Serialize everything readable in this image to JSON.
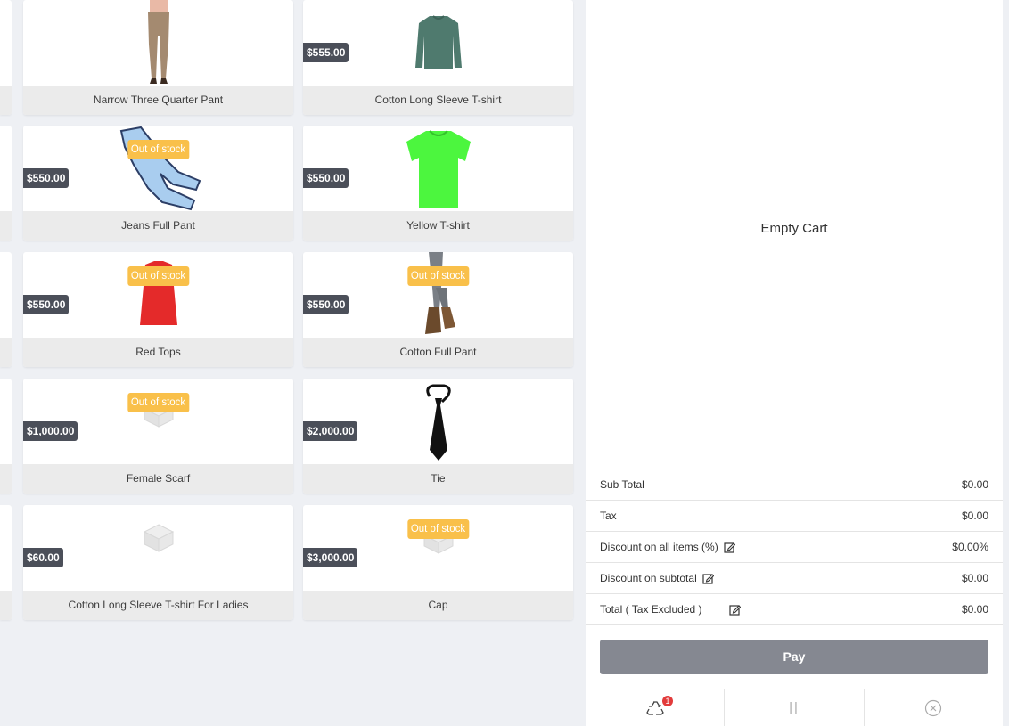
{
  "products": [
    {
      "name": "Narrow Three Quarter Pant",
      "price": "",
      "out_of_stock": false,
      "icon": "pant-icon"
    },
    {
      "name": "Cotton Long Sleeve T-shirt",
      "price": "$555.00",
      "out_of_stock": false,
      "icon": "sweater-icon"
    },
    {
      "name": "Jeans Full Pant",
      "price": "$550.00",
      "out_of_stock": true,
      "icon": "jeans-icon"
    },
    {
      "name": "Yellow T-shirt",
      "price": "$550.00",
      "out_of_stock": false,
      "icon": "tshirt-icon"
    },
    {
      "name": "Red Tops",
      "price": "$550.00",
      "out_of_stock": true,
      "icon": "top-icon"
    },
    {
      "name": "Cotton Full Pant",
      "price": "$550.00",
      "out_of_stock": true,
      "icon": "boots-icon"
    },
    {
      "name": "Female Scarf",
      "price": "$1,000.00",
      "out_of_stock": true,
      "icon": "placeholder-box-icon"
    },
    {
      "name": "Tie",
      "price": "$2,000.00",
      "out_of_stock": false,
      "icon": "tie-icon"
    },
    {
      "name": "Cotton Long Sleeve T-shirt For Ladies",
      "price": "$60.00",
      "out_of_stock": false,
      "icon": "placeholder-box-icon"
    },
    {
      "name": "Cap",
      "price": "$3,000.00",
      "out_of_stock": true,
      "icon": "placeholder-box-icon"
    }
  ],
  "out_of_stock_label": "Out of stock",
  "cart": {
    "empty_text": "Empty Cart",
    "summary": {
      "sub_total_label": "Sub Total",
      "sub_total_value": "$0.00",
      "tax_label": "Tax",
      "tax_value": "$0.00",
      "discount_items_label": "Discount on all items (%)",
      "discount_items_value": "$0.00%",
      "discount_subtotal_label": "Discount on subtotal",
      "discount_subtotal_value": "$0.00",
      "total_label": "Total ( Tax Excluded )",
      "total_value": "$0.00"
    },
    "pay_label": "Pay",
    "footer": {
      "recycle_badge": "1",
      "pause_label": "||"
    }
  },
  "colors": {
    "price_tag": "#4b4f59",
    "out_of_stock": "#f9c04a",
    "pay_button": "#858891",
    "badge": "#e23b3b"
  }
}
